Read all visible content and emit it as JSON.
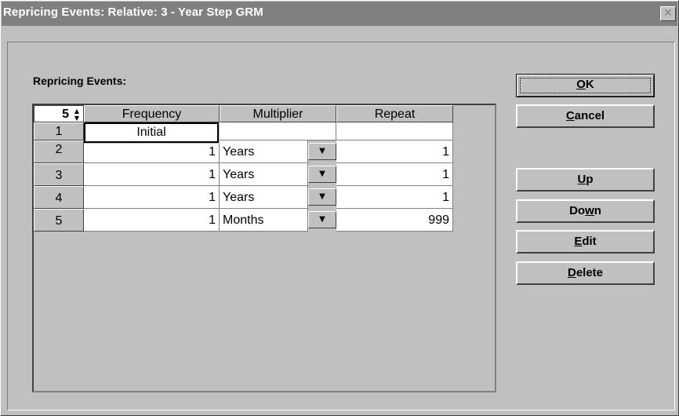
{
  "window": {
    "title": "Repricing Events: Relative: 3 - Year Step GRM",
    "close_glyph": "✕"
  },
  "group_label": "Repricing Events:",
  "grid": {
    "row_count": "5",
    "columns": [
      "Frequency",
      "Multiplier",
      "Repeat"
    ],
    "rows": [
      {
        "num": "1",
        "frequency": "Initial",
        "multiplier": "",
        "repeat": ""
      },
      {
        "num": "2",
        "frequency": "1",
        "multiplier": "Years",
        "repeat": "1"
      },
      {
        "num": "3",
        "frequency": "1",
        "multiplier": "Years",
        "repeat": "1"
      },
      {
        "num": "4",
        "frequency": "1",
        "multiplier": "Years",
        "repeat": "1"
      },
      {
        "num": "5",
        "frequency": "1",
        "multiplier": "Months",
        "repeat": "999"
      }
    ]
  },
  "buttons": {
    "ok": {
      "pre": "",
      "accel": "O",
      "post": "K"
    },
    "cancel": {
      "pre": "",
      "accel": "C",
      "post": "ancel"
    },
    "up": {
      "pre": "",
      "accel": "U",
      "post": "p"
    },
    "down": {
      "pre": "Do",
      "accel": "w",
      "post": "n"
    },
    "edit": {
      "pre": "",
      "accel": "E",
      "post": "dit"
    },
    "delete": {
      "pre": "",
      "accel": "D",
      "post": "elete"
    }
  },
  "icons": {
    "spin": "spinner-arrows-icon",
    "dropdown": "dropdown-arrow-icon"
  }
}
